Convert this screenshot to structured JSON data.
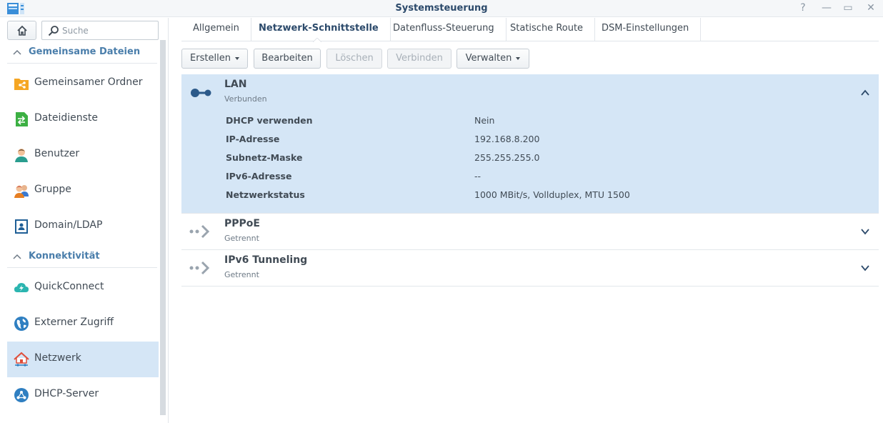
{
  "window": {
    "title": "Systemsteuerung",
    "help_glyph": "?",
    "minimize_glyph": "—",
    "maximize_glyph": "▭",
    "close_glyph": "✕"
  },
  "sidebar": {
    "search": {
      "placeholder": "Suche",
      "value": ""
    },
    "sections": [
      {
        "label": "Gemeinsame Dateien",
        "items": [
          {
            "label": "Gemeinsamer Ordner",
            "icon": "shared-folder-icon"
          },
          {
            "label": "Dateidienste",
            "icon": "file-services-icon"
          },
          {
            "label": "Benutzer",
            "icon": "user-icon"
          },
          {
            "label": "Gruppe",
            "icon": "group-icon"
          },
          {
            "label": "Domain/LDAP",
            "icon": "domain-ldap-icon"
          }
        ]
      },
      {
        "label": "Konnektivität",
        "items": [
          {
            "label": "QuickConnect",
            "icon": "quickconnect-icon"
          },
          {
            "label": "Externer Zugriff",
            "icon": "external-access-icon"
          },
          {
            "label": "Netzwerk",
            "icon": "network-icon",
            "active": true
          },
          {
            "label": "DHCP-Server",
            "icon": "dhcp-server-icon"
          }
        ]
      }
    ]
  },
  "tabs": [
    {
      "label": "Allgemein"
    },
    {
      "label": "Netzwerk-Schnittstelle",
      "active": true
    },
    {
      "label": "Datenfluss-Steuerung"
    },
    {
      "label": "Statische Route"
    },
    {
      "label": "DSM-Einstellungen"
    }
  ],
  "toolbar": {
    "create": "Erstellen",
    "edit": "Bearbeiten",
    "delete": "Löschen",
    "connect": "Verbinden",
    "manage": "Verwalten"
  },
  "interfaces": [
    {
      "name": "LAN",
      "status": "Verbunden",
      "expanded": true,
      "details": [
        {
          "key": "DHCP verwenden",
          "value": "Nein"
        },
        {
          "key": "IP-Adresse",
          "value": "192.168.8.200"
        },
        {
          "key": "Subnetz-Maske",
          "value": "255.255.255.0"
        },
        {
          "key": "IPv6-Adresse",
          "value": "--"
        },
        {
          "key": "Netzwerkstatus",
          "value": "1000 MBit/s, Vollduplex, MTU 1500"
        }
      ]
    },
    {
      "name": "PPPoE",
      "status": "Getrennt",
      "expanded": false
    },
    {
      "name": "IPv6 Tunneling",
      "status": "Getrennt",
      "expanded": false
    }
  ],
  "colors": {
    "accent": "#2c4a6b",
    "section_header": "#4a7eab",
    "selected_bg": "#d5e6f6",
    "connected_icon": "#2c5a8a",
    "disconnected_icon": "#9aa4ae"
  }
}
